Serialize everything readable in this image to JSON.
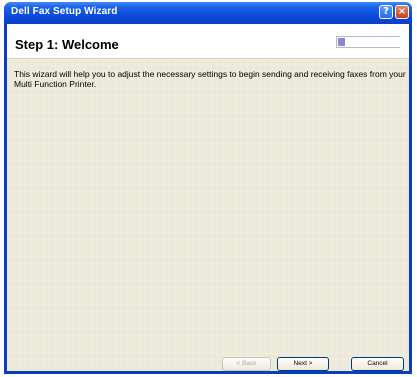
{
  "window": {
    "title": "Dell Fax Setup Wizard",
    "help_glyph": "?",
    "close_glyph": "×"
  },
  "header": {
    "step_title": "Step 1: Welcome",
    "progress_fraction": 0.12
  },
  "content": {
    "description": "This wizard will help you to adjust the necessary settings to begin sending and receiving faxes from your Multi Function Printer."
  },
  "buttons": {
    "back": "< Back",
    "next": "Next >",
    "cancel": "Cancel"
  },
  "colors": {
    "titlebar": "#0a47d8",
    "panel": "#ece9d8",
    "progress_fill": "#8a86d6"
  }
}
